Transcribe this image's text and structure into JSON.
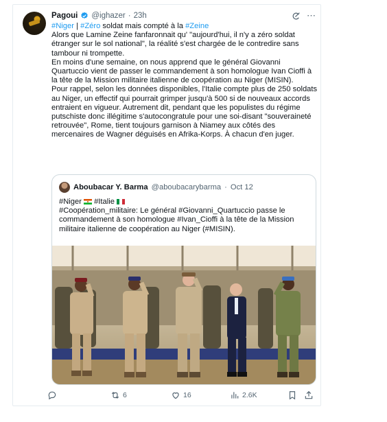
{
  "tweet": {
    "author_name": "Pagoui",
    "author_handle": "@ighazer",
    "separator": "·",
    "time": "23h",
    "body": [
      [
        {
          "t": "#Niger",
          "tag": true
        },
        {
          "t": " | ",
          "tag": false
        },
        {
          "t": "#Zéro",
          "tag": true
        },
        {
          "t": " soldat mais compté à la ",
          "tag": false
        },
        {
          "t": "#Zeine",
          "tag": true
        }
      ],
      [
        {
          "t": "Alors que Lamine Zeine fanfaronnait qu' \"aujourd'hui, il n'y a zéro soldat étranger sur le sol national\", la réalité s'est chargée de le contredire sans tambour ni trompette.",
          "tag": false
        }
      ],
      [
        {
          "t": "En moins d'une semaine, on nous apprend que le général Giovanni Quartuccio vient de passer le commandement à son homologue Ivan Cioffi à la tête de la Mission militaire italienne de coopération au Niger (MISIN).",
          "tag": false
        }
      ],
      [
        {
          "t": "Pour rappel, selon les données disponibles, l'Italie compte plus de 250 soldats au Niger, un effectif qui pourrait grimper jusqu'à 500 si de nouveaux accords entraient en vigueur. Autrement dit, pendant que les populistes du régime putschiste donc illégitime s'autocongratule pour une soi-disant \"souveraineté retrouvée\", Rome, tient toujours garnison à Niamey aux côtés des mercenaires de Wagner déguisés en Afrika-Korps.  À chacun d'en juger.",
          "tag": false
        }
      ]
    ]
  },
  "quote": {
    "author_name": "Aboubacar Y. Barma",
    "author_handle": "@aboubacarybarma",
    "separator": "·",
    "date": "Oct 12",
    "lines": [
      [
        {
          "t": "#Niger",
          "tag": false,
          "flag": "niger"
        },
        {
          "t": " #Italie",
          "tag": false,
          "flag": "italy"
        }
      ],
      [
        {
          "t": "#Coopération_militaire:  Le général #Giovanni_Quartuccio passe le commandement à son homologue #Ivan_Cioffi à la tête de la Mission militaire italienne de coopération au Niger (#MISIN).",
          "tag": false
        }
      ]
    ],
    "photo_description_icon": "photo-soldiers-saluting"
  },
  "stats": {
    "reply_count": "",
    "retweet_count": "6",
    "like_count": "16",
    "views_count": "2.6K"
  },
  "colors": {
    "link": "#1d9bf0",
    "muted": "#536471",
    "verified": "#1d9bf0",
    "niger_orange": "#e05206",
    "niger_green": "#0db02b",
    "italy_green": "#009246",
    "italy_red": "#ce2b37"
  }
}
